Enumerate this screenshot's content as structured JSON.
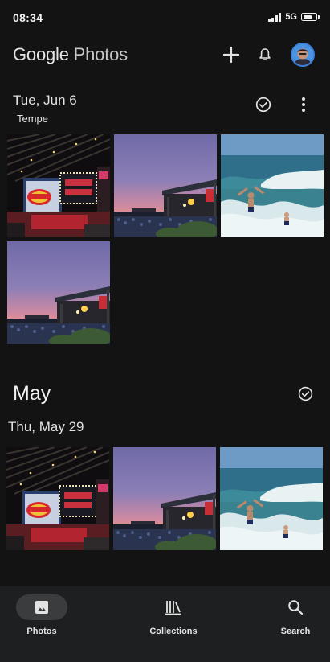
{
  "status_bar": {
    "time": "08:34",
    "network": "5G"
  },
  "header": {
    "brand": "Google",
    "product": "Photos",
    "add_icon": "plus-icon",
    "notifications_icon": "bell-icon",
    "avatar": "account-avatar"
  },
  "sections": [
    {
      "date": "Tue, Jun 6",
      "location": "Tempe",
      "select_icon": "check-circle-icon",
      "more_icon": "more-vert-icon",
      "photos": [
        "concert-venue-sign",
        "outdoor-stage-sunset",
        "ocean-waves-swimmers",
        "outdoor-stage-sunset"
      ]
    },
    {
      "month": "May",
      "date": "Thu, May 29",
      "select_icon": "check-circle-icon",
      "photos": [
        "concert-venue-sign",
        "outdoor-stage-sunset",
        "ocean-waves-swimmers"
      ]
    }
  ],
  "bottom_nav": {
    "items": [
      {
        "label": "Photos",
        "icon": "photo-icon",
        "active": true
      },
      {
        "label": "Collections",
        "icon": "library-icon",
        "active": false
      },
      {
        "label": "Search",
        "icon": "search-icon",
        "active": false
      }
    ]
  },
  "colors": {
    "background": "#131314",
    "nav_background": "#1e1f20",
    "active_pill": "#3a3c3e",
    "text": "#e3e3e3"
  }
}
